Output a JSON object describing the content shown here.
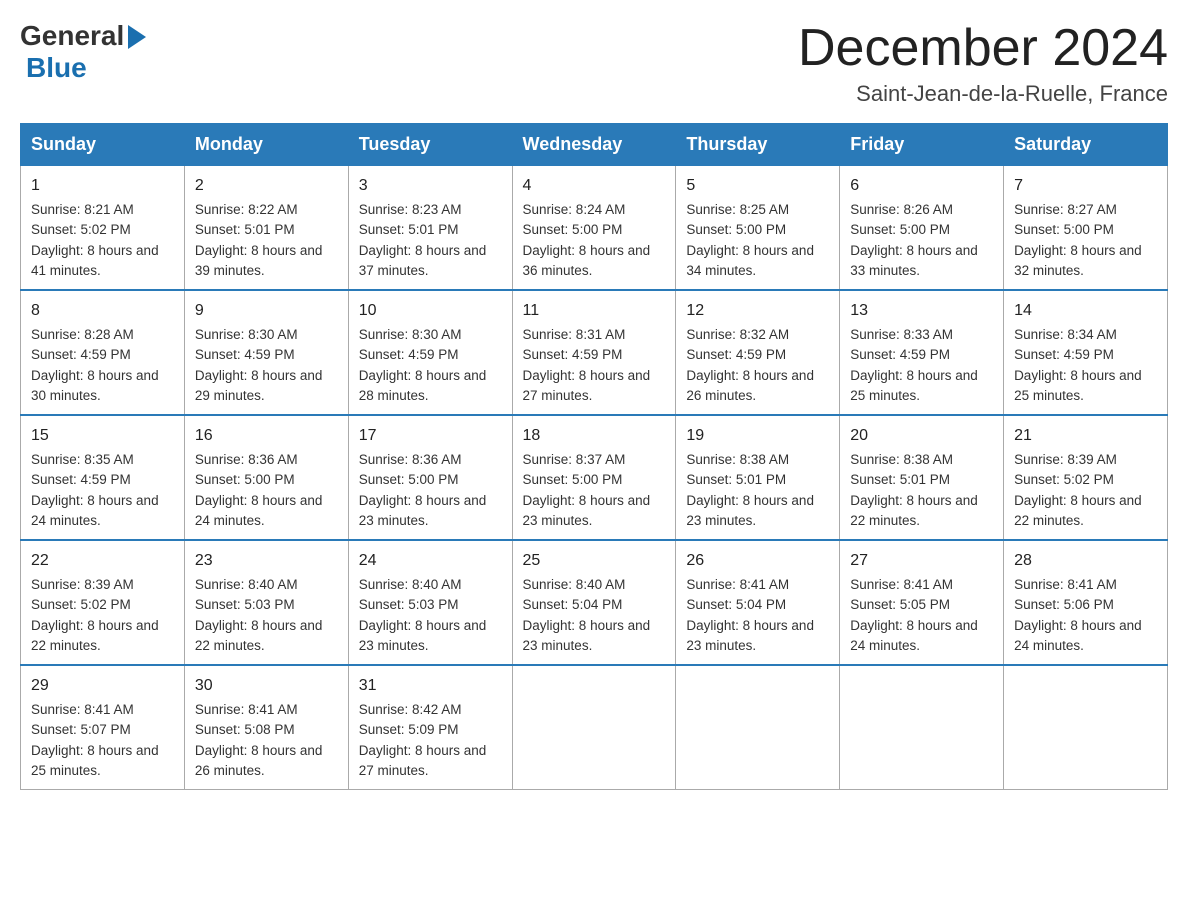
{
  "logo": {
    "general": "General",
    "blue": "Blue"
  },
  "title": "December 2024",
  "subtitle": "Saint-Jean-de-la-Ruelle, France",
  "days_of_week": [
    "Sunday",
    "Monday",
    "Tuesday",
    "Wednesday",
    "Thursday",
    "Friday",
    "Saturday"
  ],
  "weeks": [
    [
      {
        "date": "1",
        "sunrise": "8:21 AM",
        "sunset": "5:02 PM",
        "daylight": "8 hours and 41 minutes."
      },
      {
        "date": "2",
        "sunrise": "8:22 AM",
        "sunset": "5:01 PM",
        "daylight": "8 hours and 39 minutes."
      },
      {
        "date": "3",
        "sunrise": "8:23 AM",
        "sunset": "5:01 PM",
        "daylight": "8 hours and 37 minutes."
      },
      {
        "date": "4",
        "sunrise": "8:24 AM",
        "sunset": "5:00 PM",
        "daylight": "8 hours and 36 minutes."
      },
      {
        "date": "5",
        "sunrise": "8:25 AM",
        "sunset": "5:00 PM",
        "daylight": "8 hours and 34 minutes."
      },
      {
        "date": "6",
        "sunrise": "8:26 AM",
        "sunset": "5:00 PM",
        "daylight": "8 hours and 33 minutes."
      },
      {
        "date": "7",
        "sunrise": "8:27 AM",
        "sunset": "5:00 PM",
        "daylight": "8 hours and 32 minutes."
      }
    ],
    [
      {
        "date": "8",
        "sunrise": "8:28 AM",
        "sunset": "4:59 PM",
        "daylight": "8 hours and 30 minutes."
      },
      {
        "date": "9",
        "sunrise": "8:30 AM",
        "sunset": "4:59 PM",
        "daylight": "8 hours and 29 minutes."
      },
      {
        "date": "10",
        "sunrise": "8:30 AM",
        "sunset": "4:59 PM",
        "daylight": "8 hours and 28 minutes."
      },
      {
        "date": "11",
        "sunrise": "8:31 AM",
        "sunset": "4:59 PM",
        "daylight": "8 hours and 27 minutes."
      },
      {
        "date": "12",
        "sunrise": "8:32 AM",
        "sunset": "4:59 PM",
        "daylight": "8 hours and 26 minutes."
      },
      {
        "date": "13",
        "sunrise": "8:33 AM",
        "sunset": "4:59 PM",
        "daylight": "8 hours and 25 minutes."
      },
      {
        "date": "14",
        "sunrise": "8:34 AM",
        "sunset": "4:59 PM",
        "daylight": "8 hours and 25 minutes."
      }
    ],
    [
      {
        "date": "15",
        "sunrise": "8:35 AM",
        "sunset": "4:59 PM",
        "daylight": "8 hours and 24 minutes."
      },
      {
        "date": "16",
        "sunrise": "8:36 AM",
        "sunset": "5:00 PM",
        "daylight": "8 hours and 24 minutes."
      },
      {
        "date": "17",
        "sunrise": "8:36 AM",
        "sunset": "5:00 PM",
        "daylight": "8 hours and 23 minutes."
      },
      {
        "date": "18",
        "sunrise": "8:37 AM",
        "sunset": "5:00 PM",
        "daylight": "8 hours and 23 minutes."
      },
      {
        "date": "19",
        "sunrise": "8:38 AM",
        "sunset": "5:01 PM",
        "daylight": "8 hours and 23 minutes."
      },
      {
        "date": "20",
        "sunrise": "8:38 AM",
        "sunset": "5:01 PM",
        "daylight": "8 hours and 22 minutes."
      },
      {
        "date": "21",
        "sunrise": "8:39 AM",
        "sunset": "5:02 PM",
        "daylight": "8 hours and 22 minutes."
      }
    ],
    [
      {
        "date": "22",
        "sunrise": "8:39 AM",
        "sunset": "5:02 PM",
        "daylight": "8 hours and 22 minutes."
      },
      {
        "date": "23",
        "sunrise": "8:40 AM",
        "sunset": "5:03 PM",
        "daylight": "8 hours and 22 minutes."
      },
      {
        "date": "24",
        "sunrise": "8:40 AM",
        "sunset": "5:03 PM",
        "daylight": "8 hours and 23 minutes."
      },
      {
        "date": "25",
        "sunrise": "8:40 AM",
        "sunset": "5:04 PM",
        "daylight": "8 hours and 23 minutes."
      },
      {
        "date": "26",
        "sunrise": "8:41 AM",
        "sunset": "5:04 PM",
        "daylight": "8 hours and 23 minutes."
      },
      {
        "date": "27",
        "sunrise": "8:41 AM",
        "sunset": "5:05 PM",
        "daylight": "8 hours and 24 minutes."
      },
      {
        "date": "28",
        "sunrise": "8:41 AM",
        "sunset": "5:06 PM",
        "daylight": "8 hours and 24 minutes."
      }
    ],
    [
      {
        "date": "29",
        "sunrise": "8:41 AM",
        "sunset": "5:07 PM",
        "daylight": "8 hours and 25 minutes."
      },
      {
        "date": "30",
        "sunrise": "8:41 AM",
        "sunset": "5:08 PM",
        "daylight": "8 hours and 26 minutes."
      },
      {
        "date": "31",
        "sunrise": "8:42 AM",
        "sunset": "5:09 PM",
        "daylight": "8 hours and 27 minutes."
      },
      null,
      null,
      null,
      null
    ]
  ]
}
